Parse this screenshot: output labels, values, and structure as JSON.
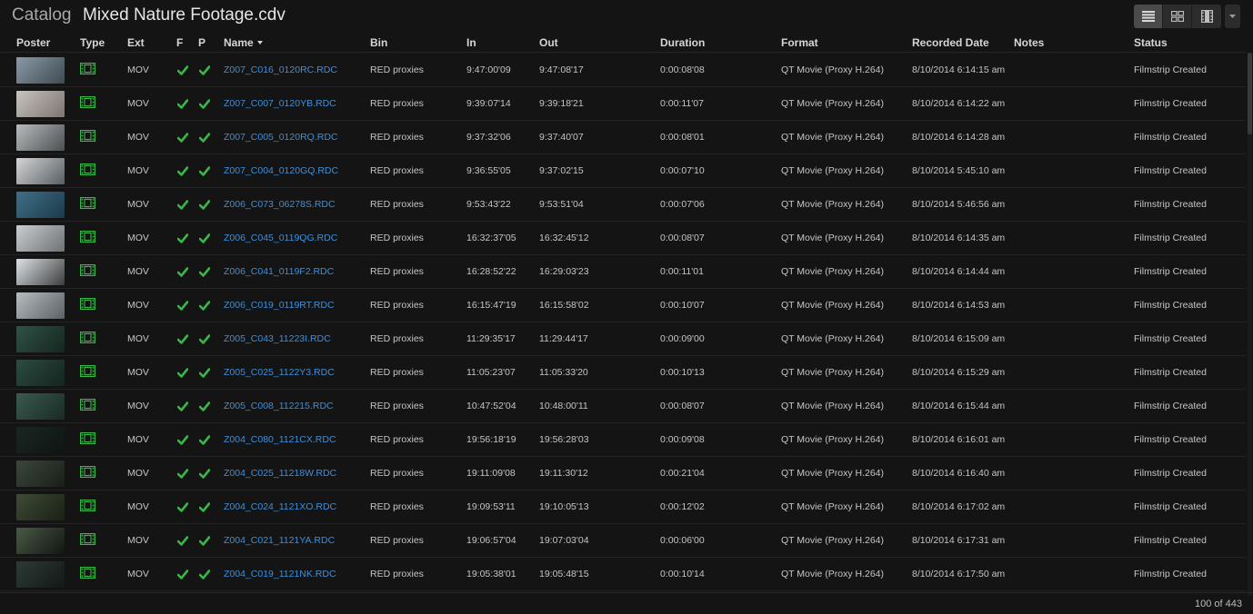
{
  "header": {
    "section": "Catalog",
    "filename": "Mixed Nature Footage.cdv",
    "view_buttons": [
      {
        "icon": "list-view-icon",
        "active": true
      },
      {
        "icon": "grid-view-icon",
        "active": false
      },
      {
        "icon": "filmstrip-view-icon",
        "active": false
      }
    ],
    "dropdown_icon": "caret-down-icon"
  },
  "columns": {
    "poster": "Poster",
    "type": "Type",
    "ext": "Ext",
    "f": "F",
    "p": "P",
    "name": "Name",
    "bin": "Bin",
    "in": "In",
    "out": "Out",
    "duration": "Duration",
    "format": "Format",
    "recorded": "Recorded Date",
    "notes": "Notes",
    "status": "Status"
  },
  "sort": {
    "column": "Name",
    "direction": "descending"
  },
  "colors": {
    "check": "#3bb54a",
    "link": "#3f8fd9",
    "type_icon": "#3bb54a"
  },
  "rows": [
    {
      "ext": "MOV",
      "name": "Z007_C016_0120RC.RDC",
      "bin": "RED proxies",
      "in": "9:47:00'09",
      "out": "9:47:08'17",
      "duration": "0:00:08'08",
      "format": "QT Movie (Proxy H.264)",
      "recorded": "8/10/2014 6:14:15 am",
      "notes": "",
      "status": "Filmstrip Created",
      "thumb": [
        "#8a9aa6",
        "#3e4a52"
      ]
    },
    {
      "ext": "MOV",
      "name": "Z007_C007_0120YB.RDC",
      "bin": "RED proxies",
      "in": "9:39:07'14",
      "out": "9:39:18'21",
      "duration": "0:00:11'07",
      "format": "QT Movie (Proxy H.264)",
      "recorded": "8/10/2014 6:14:22 am",
      "notes": "",
      "status": "Filmstrip Created",
      "thumb": [
        "#c7c4c0",
        "#7e7470"
      ]
    },
    {
      "ext": "MOV",
      "name": "Z007_C005_0120RQ.RDC",
      "bin": "RED proxies",
      "in": "9:37:32'06",
      "out": "9:37:40'07",
      "duration": "0:00:08'01",
      "format": "QT Movie (Proxy H.264)",
      "recorded": "8/10/2014 6:14:28 am",
      "notes": "",
      "status": "Filmstrip Created",
      "thumb": [
        "#b9bcbd",
        "#4a4f52"
      ]
    },
    {
      "ext": "MOV",
      "name": "Z007_C004_0120GQ.RDC",
      "bin": "RED proxies",
      "in": "9:36:55'05",
      "out": "9:37:02'15",
      "duration": "0:00:07'10",
      "format": "QT Movie (Proxy H.264)",
      "recorded": "8/10/2014 5:45:10 am",
      "notes": "",
      "status": "Filmstrip Created",
      "thumb": [
        "#d4d6d8",
        "#5a5e60"
      ]
    },
    {
      "ext": "MOV",
      "name": "Z006_C073_06278S.RDC",
      "bin": "RED proxies",
      "in": "9:53:43'22",
      "out": "9:53:51'04",
      "duration": "0:00:07'06",
      "format": "QT Movie (Proxy H.264)",
      "recorded": "8/10/2014 5:46:56 am",
      "notes": "",
      "status": "Filmstrip Created",
      "thumb": [
        "#3f6f86",
        "#1d3a4a"
      ]
    },
    {
      "ext": "MOV",
      "name": "Z006_C045_0119QG.RDC",
      "bin": "RED proxies",
      "in": "16:32:37'05",
      "out": "16:32:45'12",
      "duration": "0:00:08'07",
      "format": "QT Movie (Proxy H.264)",
      "recorded": "8/10/2014 6:14:35 am",
      "notes": "",
      "status": "Filmstrip Created",
      "thumb": [
        "#c9cdd0",
        "#6f7275"
      ]
    },
    {
      "ext": "MOV",
      "name": "Z006_C041_0119F2.RDC",
      "bin": "RED proxies",
      "in": "16:28:52'22",
      "out": "16:29:03'23",
      "duration": "0:00:11'01",
      "format": "QT Movie (Proxy H.264)",
      "recorded": "8/10/2014 6:14:44 am",
      "notes": "",
      "status": "Filmstrip Created",
      "thumb": [
        "#dfe2e4",
        "#3b3d3f"
      ]
    },
    {
      "ext": "MOV",
      "name": "Z006_C019_0119RT.RDC",
      "bin": "RED proxies",
      "in": "16:15:47'19",
      "out": "16:15:58'02",
      "duration": "0:00:10'07",
      "format": "QT Movie (Proxy H.264)",
      "recorded": "8/10/2014 6:14:53 am",
      "notes": "",
      "status": "Filmstrip Created",
      "thumb": [
        "#b7bcc0",
        "#5b6165"
      ]
    },
    {
      "ext": "MOV",
      "name": "Z005_C043_11223I.RDC",
      "bin": "RED proxies",
      "in": "11:29:35'17",
      "out": "11:29:44'17",
      "duration": "0:00:09'00",
      "format": "QT Movie (Proxy H.264)",
      "recorded": "8/10/2014 6:15:09 am",
      "notes": "",
      "status": "Filmstrip Created",
      "thumb": [
        "#2f5246",
        "#16261f"
      ]
    },
    {
      "ext": "MOV",
      "name": "Z005_C025_1122Y3.RDC",
      "bin": "RED proxies",
      "in": "11:05:23'07",
      "out": "11:05:33'20",
      "duration": "0:00:10'13",
      "format": "QT Movie (Proxy H.264)",
      "recorded": "8/10/2014 6:15:29 am",
      "notes": "",
      "status": "Filmstrip Created",
      "thumb": [
        "#2c4c42",
        "#14241e"
      ]
    },
    {
      "ext": "MOV",
      "name": "Z005_C008_112215.RDC",
      "bin": "RED proxies",
      "in": "10:47:52'04",
      "out": "10:48:00'11",
      "duration": "0:00:08'07",
      "format": "QT Movie (Proxy H.264)",
      "recorded": "8/10/2014 6:15:44 am",
      "notes": "",
      "status": "Filmstrip Created",
      "thumb": [
        "#3a5a50",
        "#1a2a25"
      ]
    },
    {
      "ext": "MOV",
      "name": "Z004_C080_1121CX.RDC",
      "bin": "RED proxies",
      "in": "19:56:18'19",
      "out": "19:56:28'03",
      "duration": "0:00:09'08",
      "format": "QT Movie (Proxy H.264)",
      "recorded": "8/10/2014 6:16:01 am",
      "notes": "",
      "status": "Filmstrip Created",
      "thumb": [
        "#1a2622",
        "#0f1513"
      ]
    },
    {
      "ext": "MOV",
      "name": "Z004_C025_11218W.RDC",
      "bin": "RED proxies",
      "in": "19:11:09'08",
      "out": "19:11:30'12",
      "duration": "0:00:21'04",
      "format": "QT Movie (Proxy H.264)",
      "recorded": "8/10/2014 6:16:40 am",
      "notes": "",
      "status": "Filmstrip Created",
      "thumb": [
        "#3b463a",
        "#191f18"
      ]
    },
    {
      "ext": "MOV",
      "name": "Z004_C024_1121XO.RDC",
      "bin": "RED proxies",
      "in": "19:09:53'11",
      "out": "19:10:05'13",
      "duration": "0:00:12'02",
      "format": "QT Movie (Proxy H.264)",
      "recorded": "8/10/2014 6:17:02 am",
      "notes": "",
      "status": "Filmstrip Created",
      "thumb": [
        "#3e4a36",
        "#1a2016"
      ]
    },
    {
      "ext": "MOV",
      "name": "Z004_C021_1121YA.RDC",
      "bin": "RED proxies",
      "in": "19:06:57'04",
      "out": "19:07:03'04",
      "duration": "0:00:06'00",
      "format": "QT Movie (Proxy H.264)",
      "recorded": "8/10/2014 6:17:31 am",
      "notes": "",
      "status": "Filmstrip Created",
      "thumb": [
        "#4a5a46",
        "#111512"
      ]
    },
    {
      "ext": "MOV",
      "name": "Z004_C019_1121NK.RDC",
      "bin": "RED proxies",
      "in": "19:05:38'01",
      "out": "19:05:48'15",
      "duration": "0:00:10'14",
      "format": "QT Movie (Proxy H.264)",
      "recorded": "8/10/2014 6:17:50 am",
      "notes": "",
      "status": "Filmstrip Created",
      "thumb": [
        "#2e3b36",
        "#121816"
      ]
    }
  ],
  "footer": {
    "count": "100 of 443"
  }
}
